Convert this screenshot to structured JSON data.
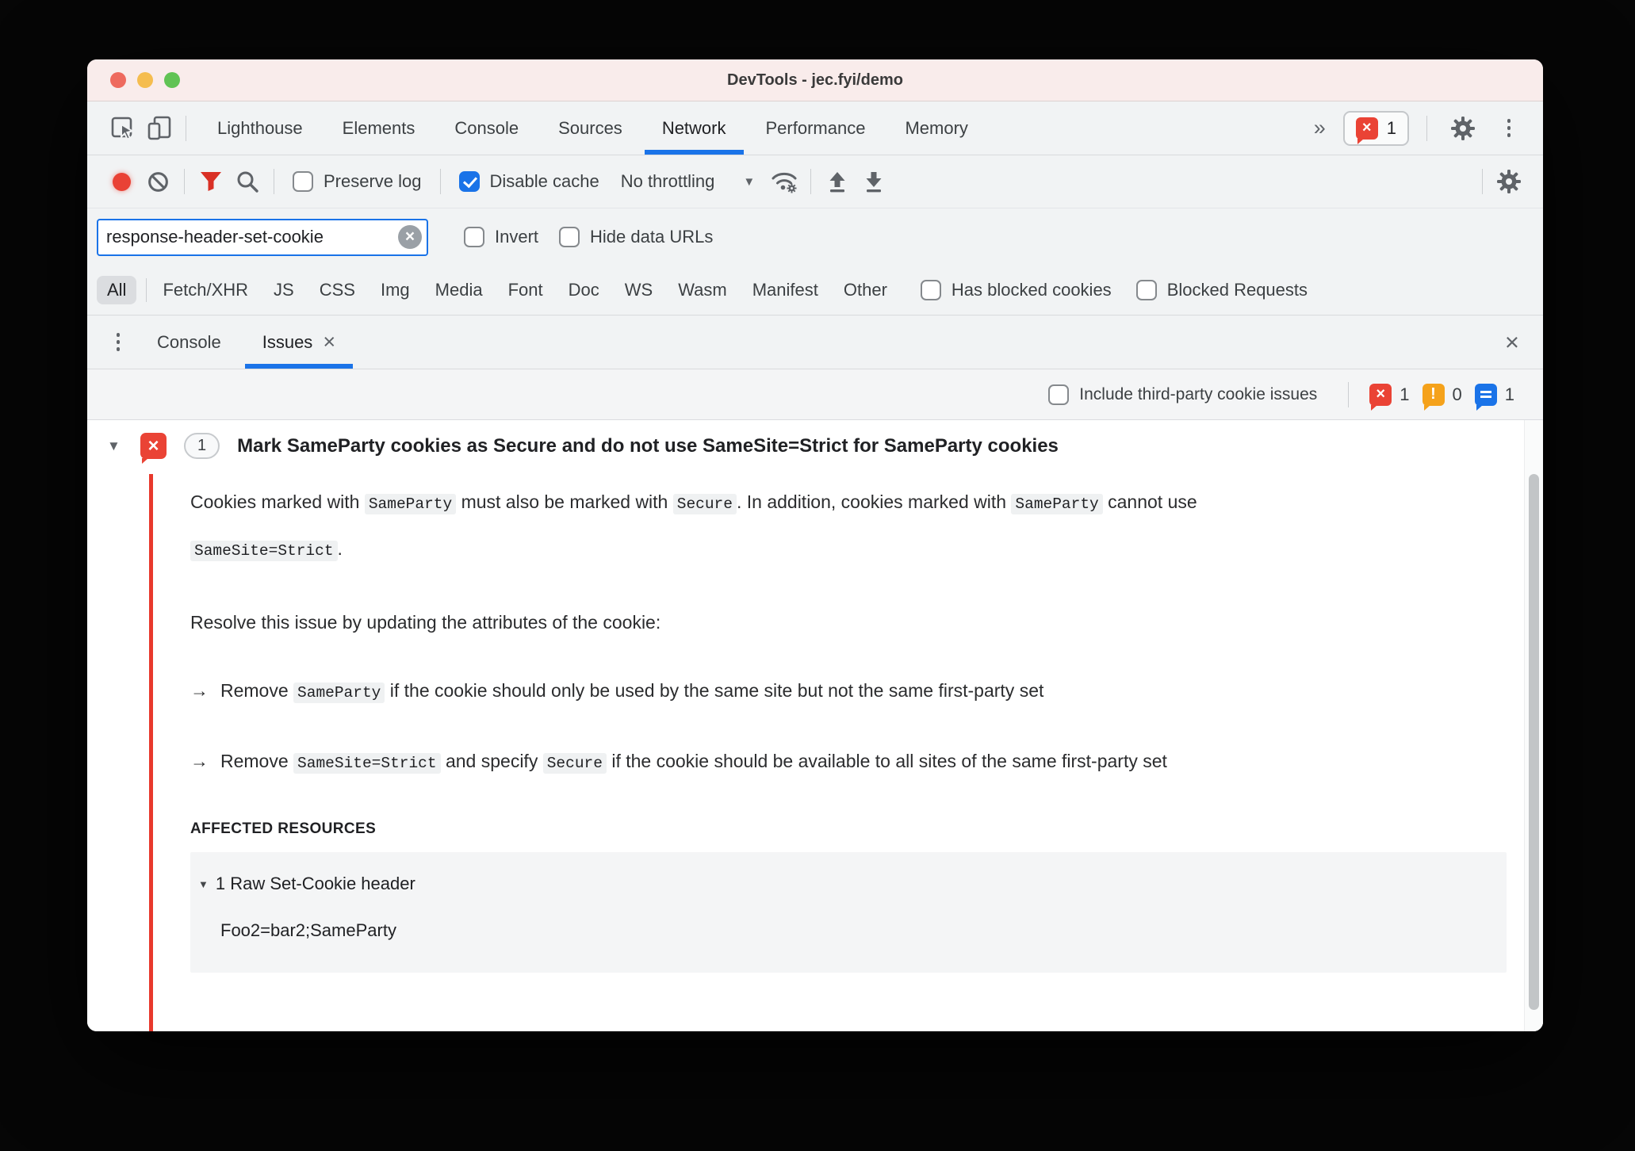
{
  "titlebar": {
    "title": "DevTools - jec.fyi/demo"
  },
  "icons": {
    "more_tabs": "»",
    "dropdown_caret": "▼",
    "expand_triangle": "▼",
    "resource_triangle": "▼",
    "close": "×",
    "clear_input": "×",
    "bullet_arrow": "→",
    "badge_error_x": "×",
    "badge_warning_mark": "!"
  },
  "colors": {
    "accent_blue": "#1A73E8",
    "error_red": "#EA4335",
    "warning_orange": "#F5A21B",
    "filter_red": "#D93025"
  },
  "main_tabs": {
    "tabs": [
      {
        "label": "Lighthouse"
      },
      {
        "label": "Elements"
      },
      {
        "label": "Console"
      },
      {
        "label": "Sources"
      },
      {
        "label": "Network"
      },
      {
        "label": "Performance"
      },
      {
        "label": "Memory"
      }
    ],
    "active_tab": "Network",
    "error_badge_count": "1"
  },
  "network_toolbar": {
    "preserve_log": {
      "label": "Preserve log",
      "checked": false
    },
    "disable_cache": {
      "label": "Disable cache",
      "checked": true
    },
    "throttling": {
      "value": "No throttling"
    }
  },
  "filter_bar": {
    "filter_input": {
      "value": "response-header-set-cookie"
    },
    "invert": {
      "label": "Invert",
      "checked": false
    },
    "hide_data_urls": {
      "label": "Hide data URLs",
      "checked": false
    }
  },
  "request_type_bar": {
    "all": {
      "label": "All",
      "selected": true
    },
    "types": [
      "Fetch/XHR",
      "JS",
      "CSS",
      "Img",
      "Media",
      "Font",
      "Doc",
      "WS",
      "Wasm",
      "Manifest",
      "Other"
    ],
    "has_blocked_cookies": {
      "label": "Has blocked cookies",
      "checked": false
    },
    "blocked_requests": {
      "label": "Blocked Requests",
      "checked": false
    }
  },
  "drawer": {
    "console_label": "Console",
    "issues_label": "Issues",
    "active_tab": "Issues"
  },
  "issues_toolbar": {
    "include_third_party": {
      "label": "Include third-party cookie issues",
      "checked": false
    },
    "counts": {
      "errors": "1",
      "warnings": "0",
      "messages": "1"
    }
  },
  "issue": {
    "count": "1",
    "title": "Mark SameParty cookies as Secure and do not use SameSite=Strict for SameParty cookies",
    "description": {
      "s1": "Cookies marked with ",
      "c1": "SameParty",
      "s2": " must also be marked with ",
      "c2": "Secure",
      "s3": ". In addition, cookies marked with ",
      "c3": "SameParty",
      "s4": " cannot use ",
      "c4": "SameSite=Strict",
      "s5": "."
    },
    "resolution_intro": "Resolve this issue by updating the attributes of the cookie:",
    "resolutions": [
      {
        "s1": "Remove ",
        "c1": "SameParty",
        "s2": " if the cookie should only be used by the same site but not the same first-party set"
      },
      {
        "s1": "Remove ",
        "c1": "SameSite=Strict",
        "s2": " and specify ",
        "c2": "Secure",
        "s3": " if the cookie should be available to all sites of the same first-party set"
      }
    ],
    "affected_resources": {
      "heading": "AFFECTED RESOURCES",
      "group_label": "1 Raw Set-Cookie header",
      "items": [
        "Foo2=bar2;SameParty"
      ]
    }
  }
}
